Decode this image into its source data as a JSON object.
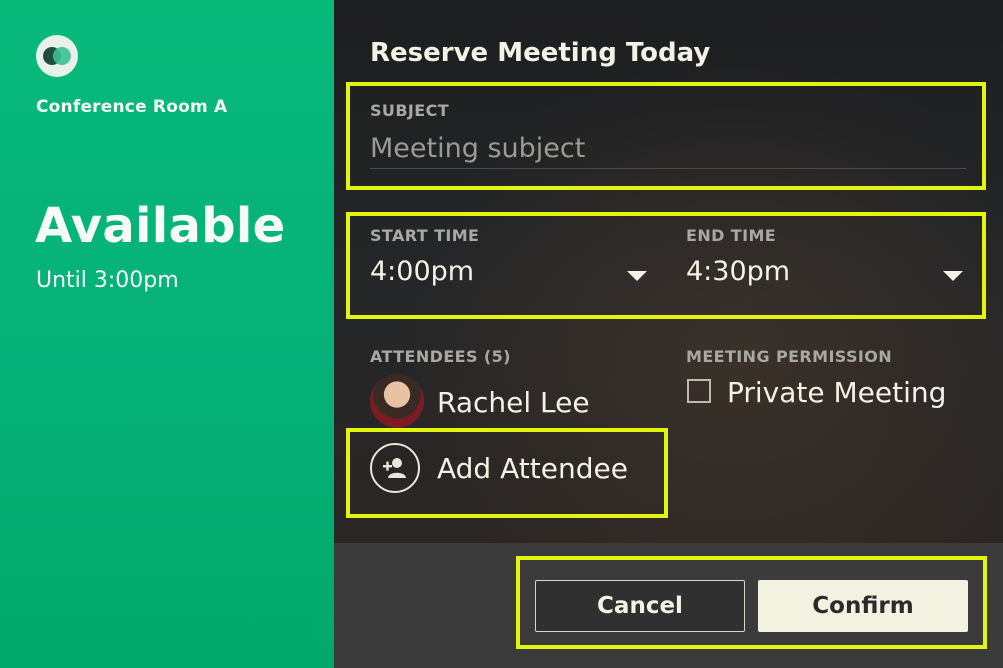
{
  "room": {
    "name": "Conference Room A",
    "status": "Available",
    "until": "Until 3:00pm"
  },
  "form": {
    "title": "Reserve Meeting Today",
    "subject": {
      "label": "SUBJECT",
      "placeholder": "Meeting subject",
      "value": ""
    },
    "start_time": {
      "label": "START TIME",
      "value": "4:00pm"
    },
    "end_time": {
      "label": "END TIME",
      "value": "4:30pm"
    },
    "attendees": {
      "label": "ATTENDEES (5)",
      "list": [
        {
          "name": "Rachel Lee"
        }
      ],
      "add_label": "Add Attendee"
    },
    "permission": {
      "label": "MEETING PERMISSION",
      "checkbox_label": "Private Meeting",
      "checked": false
    }
  },
  "actions": {
    "cancel_label": "Cancel",
    "confirm_label": "Confirm"
  },
  "colors": {
    "accent_green": "#05b077",
    "highlight": "#e2f50f",
    "panel_dark": "#1f2022",
    "confirm_bg": "#f3f1df"
  },
  "icons": {
    "logo": "overlapping-circles-logo",
    "dropdown": "caret-down-icon",
    "add_person": "add-person-icon",
    "checkbox": "checkbox-icon"
  }
}
